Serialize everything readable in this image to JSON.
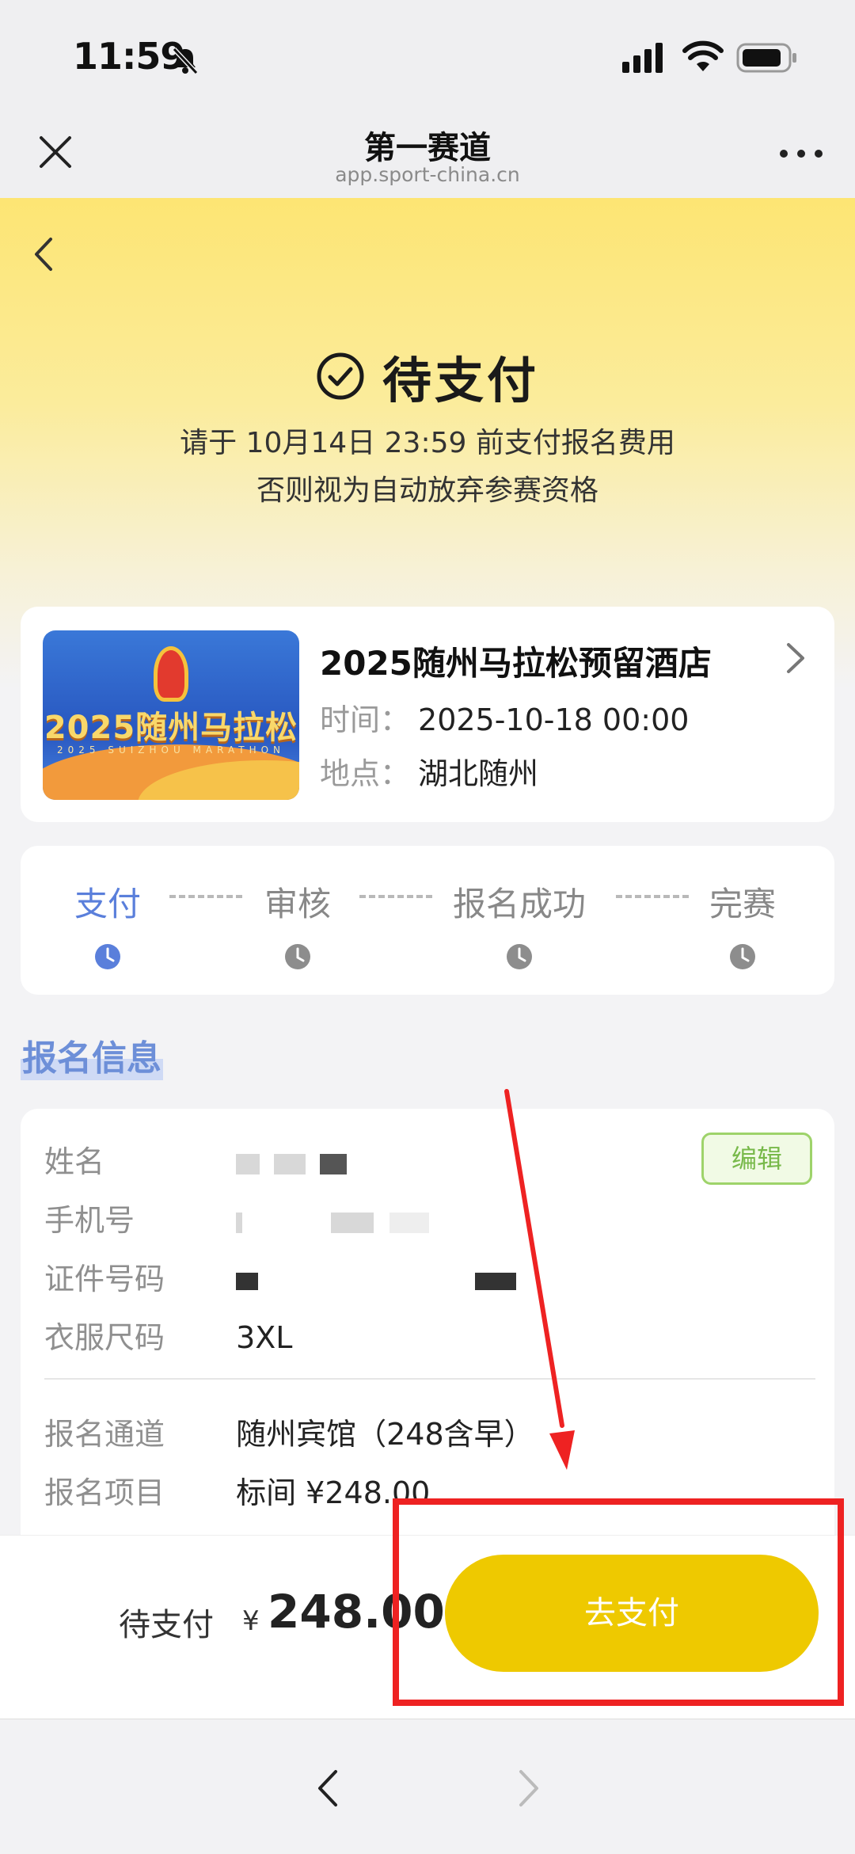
{
  "status_bar": {
    "time": "11:59"
  },
  "browser": {
    "title": "第一赛道",
    "url": "app.sport-china.cn"
  },
  "status": {
    "title": "待支付",
    "line1": "请于 10月14日 23:59 前支付报名费用",
    "line2": "否则视为自动放弃参赛资格"
  },
  "event": {
    "name": "2025随州马拉松预留酒店",
    "time_label": "时间：",
    "time_value": "2025-10-18 00:00",
    "place_label": "地点：",
    "place_value": "湖北随州",
    "image_title": "2025随州马拉松",
    "image_subtitle": "2025 SUIZHOU MARATHON"
  },
  "steps": [
    {
      "label": "支付",
      "active": true
    },
    {
      "label": "审核",
      "active": false
    },
    {
      "label": "报名成功",
      "active": false
    },
    {
      "label": "完赛",
      "active": false
    }
  ],
  "section_title": "报名信息",
  "info": {
    "edit_label": "编辑",
    "name_label": "姓名",
    "phone_label": "手机号",
    "id_label": "证件号码",
    "size_label": "衣服尺码",
    "size_value": "3XL",
    "channel_label": "报名通道",
    "channel_value": "随州宾馆（248含早）",
    "item_label": "报名项目",
    "item_value": "标间 ¥248.00"
  },
  "pay": {
    "label": "待支付",
    "currency": "¥",
    "amount": "248.00",
    "button": "去支付"
  },
  "colors": {
    "accent_yellow": "#eec900",
    "active_blue": "#5a7fdb",
    "annotation_red": "#ee2222",
    "edit_green": "#78b94a"
  }
}
